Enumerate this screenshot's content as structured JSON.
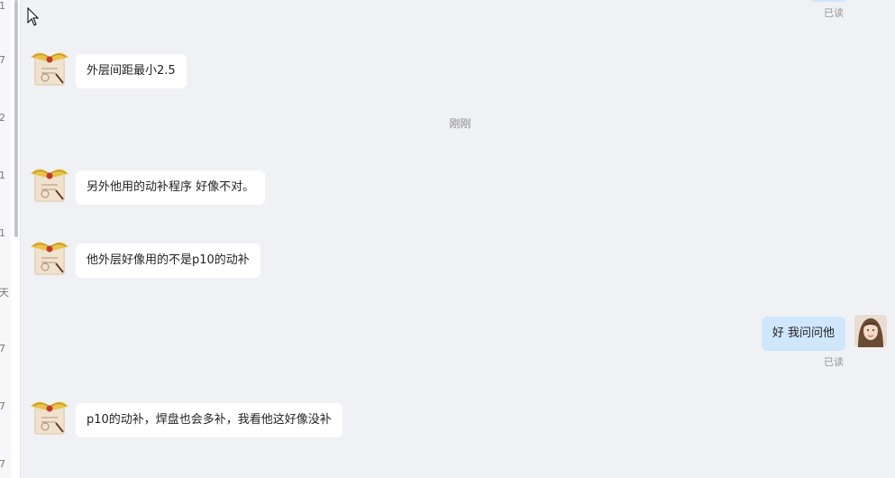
{
  "left_strip_fragments": [
    "1",
    "7",
    "2",
    "1",
    "1",
    "天",
    "7",
    "7",
    "7"
  ],
  "read_status": "已读",
  "time_divider": "刚刚",
  "messages": [
    {
      "side": "in",
      "text": "外层间距最小2.5"
    },
    {
      "side": "in",
      "text": "另外他用的动补程序 好像不对。"
    },
    {
      "side": "in",
      "text": "他外层好像用的不是p10的动补"
    },
    {
      "side": "out",
      "text": "好  我问问他"
    },
    {
      "side": "in",
      "text": "p10的动补，焊盘也会多补，我看他这好像没补"
    }
  ],
  "colors": {
    "background": "#f0f1f4",
    "incoming_bubble": "#ffffff",
    "outgoing_bubble": "#cfe6fb",
    "muted_text": "#999999"
  },
  "icons": {
    "contact_avatar": "winged-scroll-avatar",
    "self_avatar": "user-photo-avatar",
    "cursor": "mouse-pointer-icon"
  }
}
